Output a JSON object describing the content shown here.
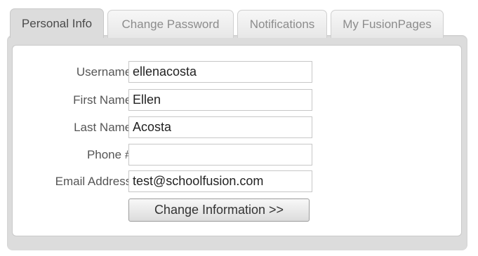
{
  "tabs": [
    {
      "label": "Personal Info",
      "active": true
    },
    {
      "label": "Change Password",
      "active": false
    },
    {
      "label": "Notifications",
      "active": false
    },
    {
      "label": "My FusionPages",
      "active": false
    }
  ],
  "form": {
    "username": {
      "label": "Username:",
      "value": "ellenacosta"
    },
    "first_name": {
      "label": "First Name:",
      "value": "Ellen"
    },
    "last_name": {
      "label": "Last Name:",
      "value": "Acosta"
    },
    "phone": {
      "label": "Phone #:",
      "value": ""
    },
    "email": {
      "label": "Email Address:",
      "value": "test@schoolfusion.com"
    },
    "submit_label": "Change Information >>"
  }
}
